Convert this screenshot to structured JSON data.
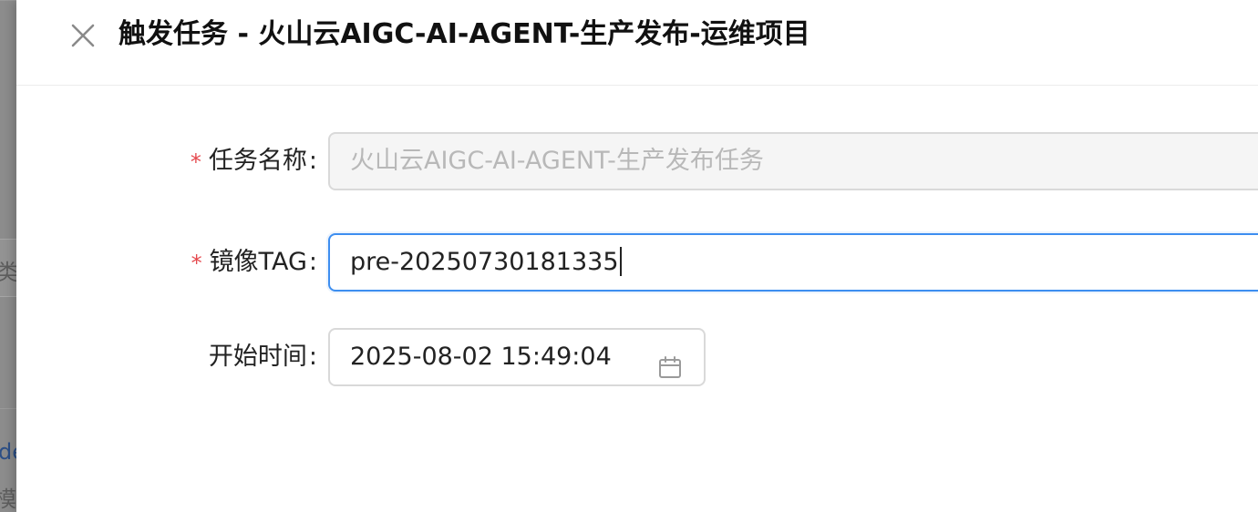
{
  "background": {
    "fragments": [
      "类型",
      "de",
      "模板"
    ]
  },
  "drawer": {
    "title": "触发任务 - 火山云AIGC-AI-AGENT-生产发布-运维项目",
    "close_icon": "close-icon"
  },
  "form": {
    "colon": ":",
    "required_mark": "*",
    "task_name": {
      "label": "任务名称",
      "value": "火山云AIGC-AI-AGENT-生产发布任务",
      "disabled": true,
      "required": true
    },
    "image_tag": {
      "label": "镜像TAG",
      "value": "pre-20250730181335",
      "focused": true,
      "required": true
    },
    "start_time": {
      "label": "开始时间",
      "value": "2025-08-02 15:49:04",
      "icon": "calendar-icon",
      "required": false
    }
  },
  "colors": {
    "accent": "#3d8ef0",
    "required": "#e5484d",
    "disabled_bg": "#f5f5f5"
  }
}
